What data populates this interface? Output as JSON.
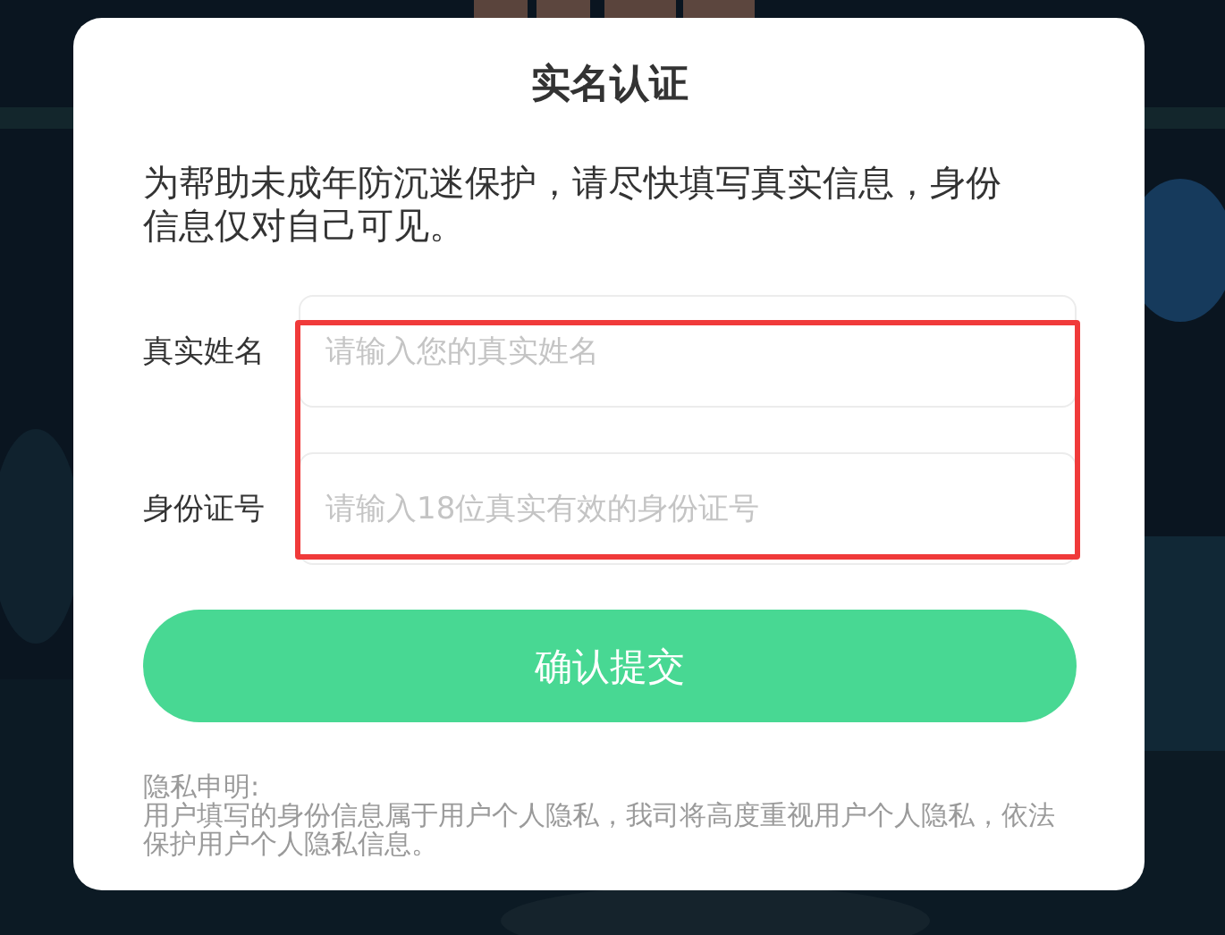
{
  "title": "实名认证",
  "description": "为帮助未成年防沉迷保护，请尽快填写真实信息，身份信息仅对自己可见。",
  "fields": [
    {
      "label": "真实姓名",
      "placeholder": "请输入您的真实姓名"
    },
    {
      "label": "身份证号",
      "placeholder": "请输入18位真实有效的身份证号"
    }
  ],
  "fields_highlighted": true,
  "submit_button": "确认提交",
  "privacy": {
    "heading": "隐私申明:",
    "text": "用户填写的身份信息属于用户个人隐私，我司将高度重视用户个人隐私，依法保护用户个人隐私信息。"
  }
}
